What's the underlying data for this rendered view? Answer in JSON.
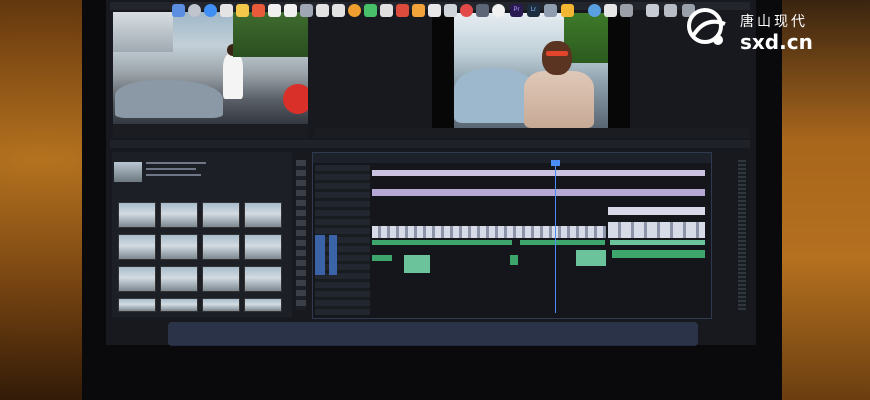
{
  "watermark": {
    "chinese": "唐山现代",
    "domain": "sxd.cn"
  },
  "scene": {
    "description_tags": [
      "monitor",
      "video-editing-software",
      "timeline",
      "source-monitor",
      "program-monitor",
      "media-bin",
      "dock"
    ]
  }
}
